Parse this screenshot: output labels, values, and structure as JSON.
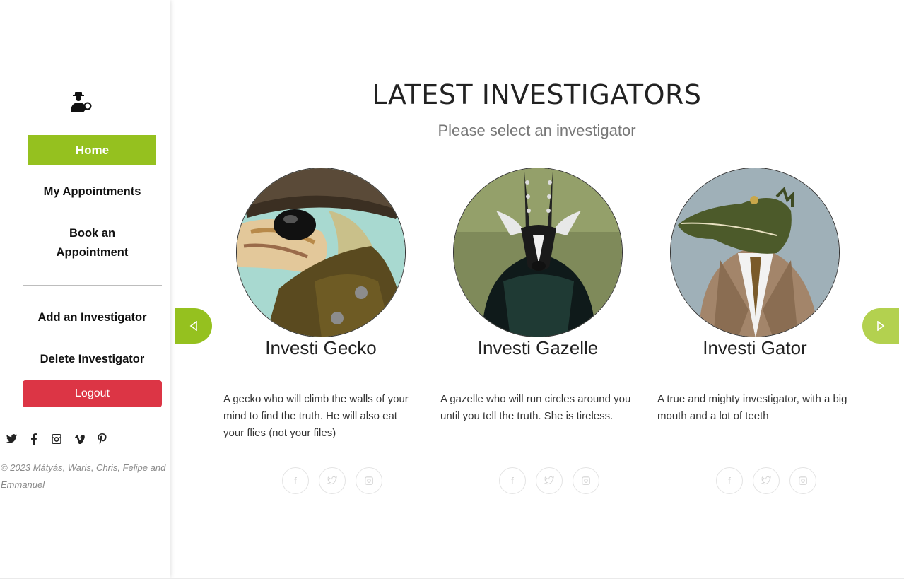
{
  "sidebar": {
    "nav": {
      "home": "Home",
      "my_appointments": "My Appointments",
      "book_line1": "Book an",
      "book_line2": "Appointment",
      "add_investigator": "Add an Investigator",
      "delete_investigator": "Delete Investigator"
    },
    "logout": "Logout",
    "social_icons": [
      "twitter-icon",
      "facebook-icon",
      "instagram-icon",
      "vimeo-icon",
      "pinterest-icon"
    ],
    "copyright_line1": "© 2023 Mátyás, Waris, Chris, Felipe and",
    "copyright_line2": "Emmanuel"
  },
  "main": {
    "title": "LATEST INVESTIGATORS",
    "subtitle": "Please select an investigator",
    "investigators": [
      {
        "name": "Investi Gecko",
        "desc_lines": [
          "A gecko who will climb the walls of your",
          "mind to find the truth. He will also eat",
          "your flies (not your files)"
        ]
      },
      {
        "name": "Investi Gazelle",
        "desc_lines": [
          "A gazelle who will run circles around you",
          "until you tell the truth. She is tireless."
        ]
      },
      {
        "name": "Investi Gator",
        "desc_lines": [
          "A true and mighty investigator, with a big",
          "mouth and a lot of teeth"
        ]
      }
    ],
    "card_social_icons": [
      "facebook-icon",
      "twitter-icon",
      "instagram-icon"
    ]
  },
  "colors": {
    "accent": "#95c11f",
    "logout": "#dc3545"
  }
}
